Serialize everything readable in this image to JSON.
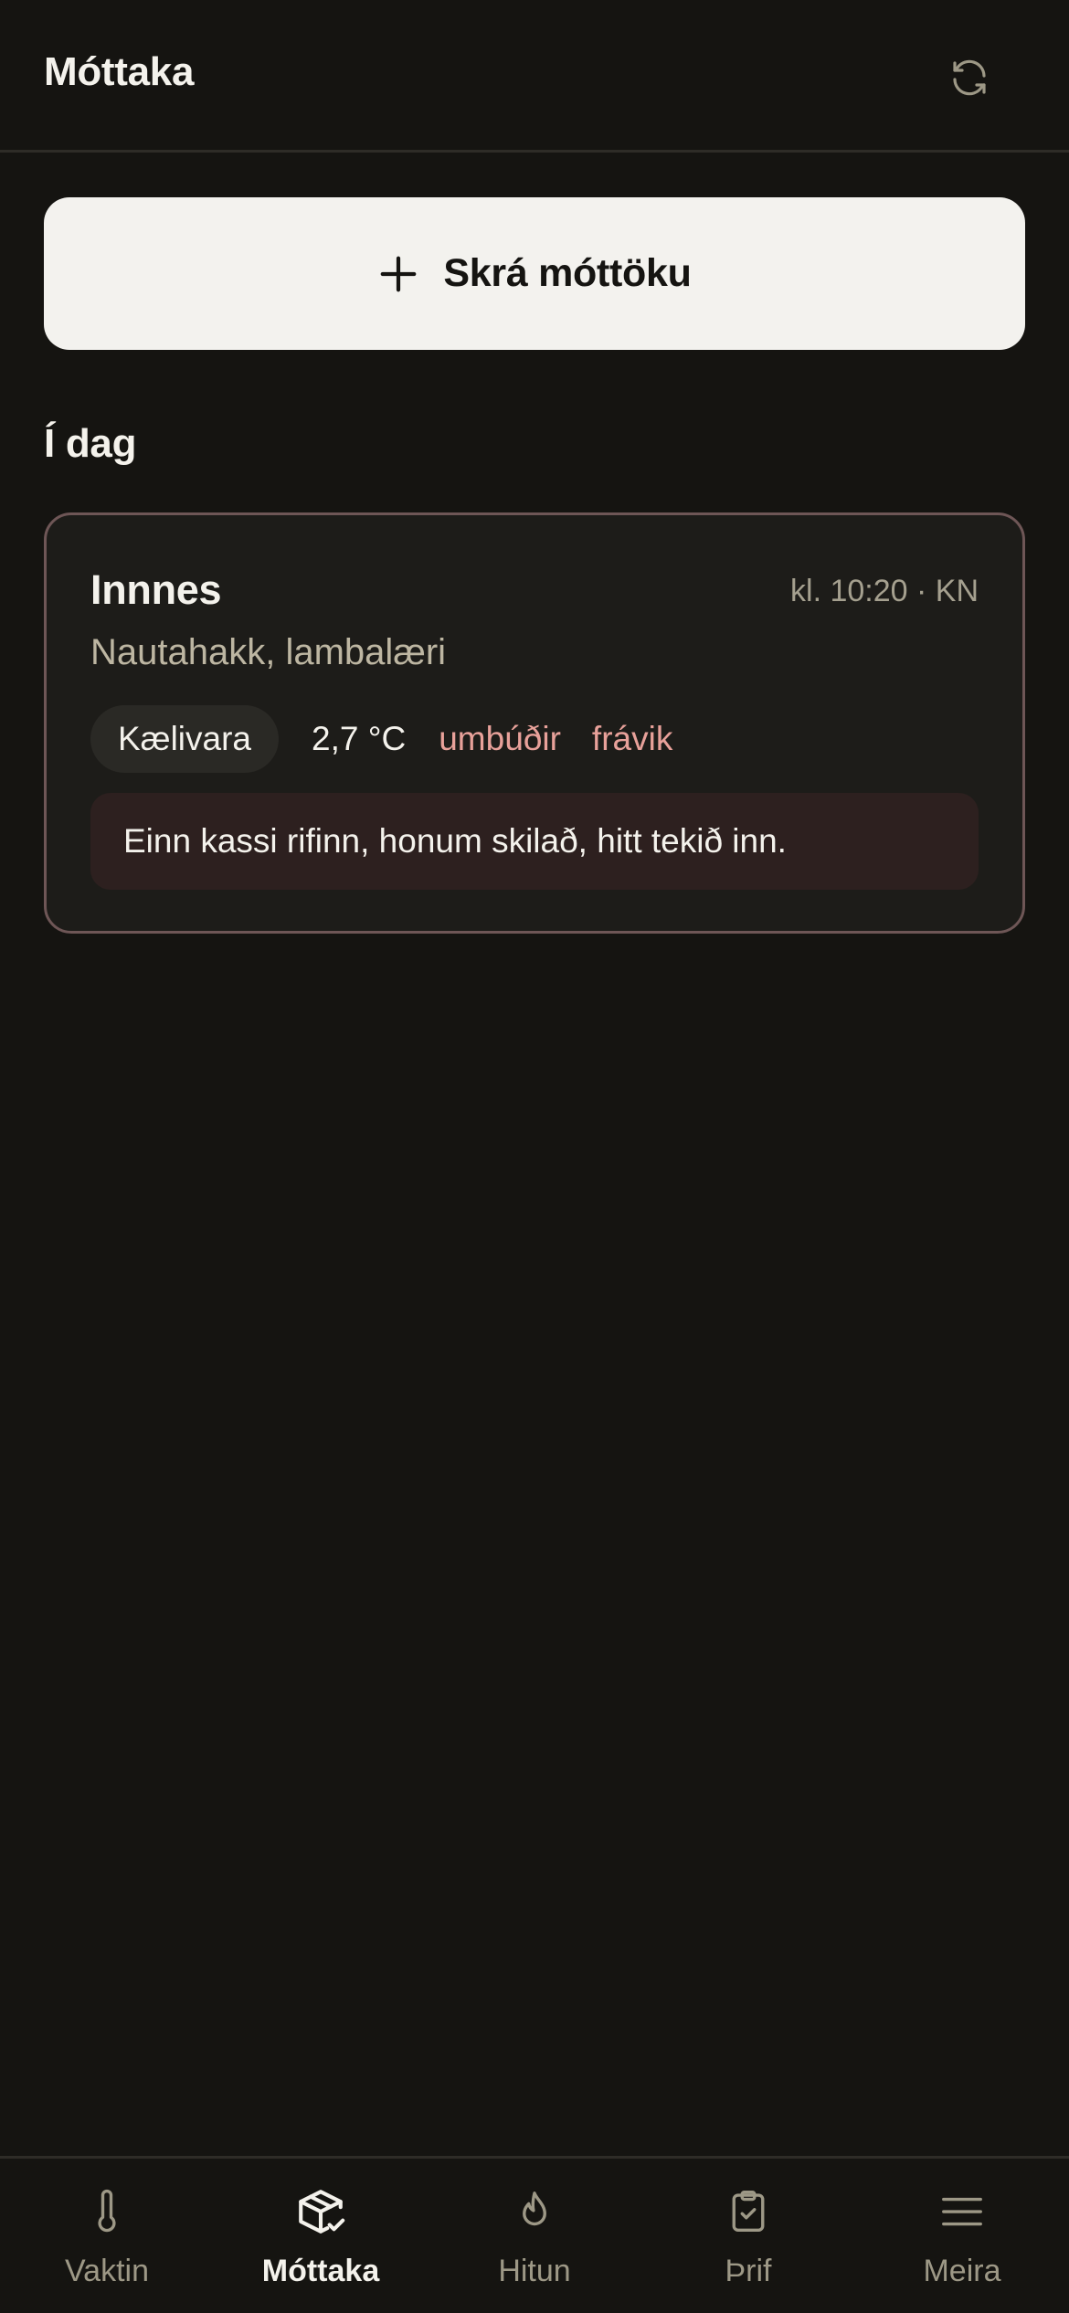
{
  "header": {
    "title": "Móttaka",
    "refresh_icon": "refresh-icon"
  },
  "register_button": {
    "label": "Skrá móttöku",
    "icon": "plus-icon"
  },
  "section": {
    "title": "Í dag"
  },
  "entries": [
    {
      "supplier": "Innnes",
      "meta": "kl. 10:20 · KN",
      "products": "Nautahakk, lambalæri",
      "category": "Kælivara",
      "temperature": "2,7 °C",
      "flags": [
        "umbúðir",
        "frávik"
      ],
      "note": "Einn kassi rifinn, honum skilað, hitt tekið inn."
    }
  ],
  "nav": {
    "active": "Móttaka",
    "items": [
      {
        "label": "Vaktin",
        "icon": "thermometer-icon"
      },
      {
        "label": "Móttaka",
        "icon": "package-check-icon"
      },
      {
        "label": "Hitun",
        "icon": "flame-icon"
      },
      {
        "label": "Þrif",
        "icon": "clipboard-check-icon"
      },
      {
        "label": "Meira",
        "icon": "menu-icon"
      }
    ]
  },
  "colors": {
    "background": "#151411",
    "text": "#f4f2ec",
    "muted": "#a5a08f",
    "warning": "#e8a19a",
    "card_border": "#6e5656",
    "note_bg": "#2d201f",
    "button_bg": "#f3f2ee"
  }
}
